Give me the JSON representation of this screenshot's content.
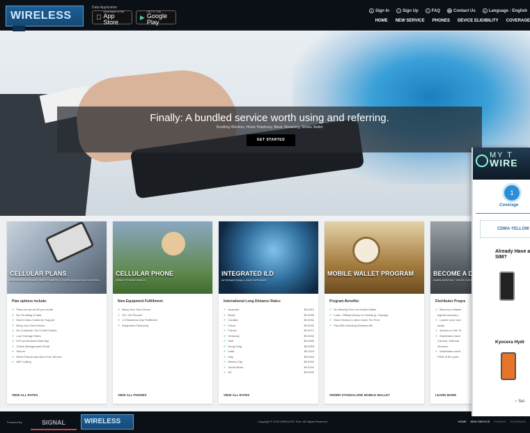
{
  "header": {
    "logo": "WIRELESS",
    "logo_badge": "TIME",
    "app_label": "Data Application",
    "app_store": {
      "small": "Download on the",
      "large": "App Store"
    },
    "google_play": {
      "small": "GET IT ON",
      "large": "Google Play"
    },
    "util": [
      "Sign In",
      "Sign Up",
      "FAQ",
      "Contact Us",
      "Language : English"
    ],
    "nav": [
      "HOME",
      "NEW SERVICE",
      "PHONES",
      "DEVICE ELIGIBILITY",
      "COVERAGE"
    ]
  },
  "hero": {
    "title": "Finally: A bundled service worth using and referring.",
    "subtitle": "Bundling Wireless, Home Telephony, Music Streaming, Mobile Wallet",
    "button": "GET STARTED"
  },
  "cards": [
    {
      "overlay": "CELLULAR PLANS",
      "overlay_sub": "NO CONTRACT AND CREDIT CHECK, YOU'RE ALWAYS IN CONTROL",
      "heading": "Plan options include:",
      "items": [
        "Plans as low as $X per month",
        "No Throttling of data",
        "World Class Customer Support",
        "Bring Your Own Device",
        "No Contracts / No Credit Checks",
        "Low Overage Rates",
        "iOS and Android Data App",
        "Online Management Portal",
        "Secure",
        "Refer Friends and Earn Free Service",
        "WiFi Calling"
      ],
      "footer": "VIEW ALL RATES"
    },
    {
      "overlay": "CELLULAR PHONE",
      "overlay_sub": "GREAT PHONE DEALS",
      "heading": "New Equipment Fulfillment:",
      "items": [
        "Bring Your Own Device",
        "3G / 4G Phones",
        "2-3 Business Day Fulfillment",
        "Equipment Financing"
      ],
      "footer": "VIEW ALL PHONES"
    },
    {
      "overlay": "INTEGRATED ILD",
      "overlay_sub": "INTERNATIONAL LONG DISTANCE",
      "heading": "International Long Distance Rates:",
      "rates": [
        [
          "Australia",
          "$0.0321"
        ],
        [
          "Brazil",
          "$0.0095"
        ],
        [
          "Canada",
          "$0.0032"
        ],
        [
          "China",
          "$0.0032"
        ],
        [
          "France",
          "$0.0071"
        ],
        [
          "Germany",
          "$0.0040"
        ],
        [
          "Haiti",
          "$0.0496"
        ],
        [
          "Hong Kong",
          "$0.0059"
        ],
        [
          "India",
          "$0.0118"
        ],
        [
          "Italy",
          "$0.0040"
        ],
        [
          "Mexico City",
          "$0.0032"
        ],
        [
          "South Africa",
          "$0.0154"
        ],
        [
          "UK",
          "$0.0032"
        ]
      ],
      "footer": "VIEW ALL RATES"
    },
    {
      "overlay": "MOBILE WALLET PROGRAM",
      "overlay_sub": "",
      "heading": "Program Benefits:",
      "items": [
        "No Monthly Fees on Mobile Wallet",
        "Load / Offload Money to Checking / Savings",
        "Move Money to other Users For Free",
        "Pay Bills Including Wireless Bill"
      ],
      "footer": "ORDER STANDALONE MOBILE WALLET"
    },
    {
      "overlay": "BECOME A DI",
      "overlay_sub": "EARN MONTHLY YOUR CUSTOMER BA",
      "heading": "Distributor Progra",
      "items": [
        "Become a Master",
        "highest industry c",
        "Launch your own",
        "today",
        "Access to eTel Te",
        "Distributors have",
        "Carriers, Internati",
        "Services",
        "Distributors recei",
        "PINS at the point"
      ],
      "footer": "LEARN MORE"
    }
  ],
  "widget": {
    "brand_top": "MY T",
    "brand_main": "WIRE",
    "step_number": "1",
    "step_label": "Coverage",
    "tab": "CDMA-YELLOW",
    "question": "Already Have and SIM?",
    "device": "Kyocera Hydr",
    "select": "Sel"
  },
  "footer": {
    "powered": "Powered By",
    "signal": "SIGNAL",
    "logo": "WIRELESS",
    "copyright": "Copyright © 2019 WIRELESS Time. All Rights Reserved",
    "nav": [
      "HOME",
      "NEW SERVICE",
      "PHONES",
      "COVERAGE"
    ]
  }
}
